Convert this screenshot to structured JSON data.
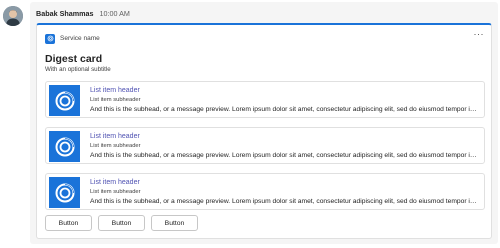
{
  "message": {
    "sender": "Babak Shammas",
    "time": "10:00 AM"
  },
  "card": {
    "service_name": "Service name",
    "more_label": "···",
    "title": "Digest card",
    "subtitle": "With an optional subtitle",
    "items": [
      {
        "header": "List item header",
        "subheader": "List item subheader",
        "preview": "And this is the subhead, or a message preview. Lorem ipsum dolor sit amet, consectetur adipiscing elit, sed do eiusmod tempor incididunt ut labore et dolore magna aliqua."
      },
      {
        "header": "List item header",
        "subheader": "List item subheader",
        "preview": "And this is the subhead, or a message preview. Lorem ipsum dolor sit amet, consectetur adipiscing elit, sed do eiusmod tempor incididunt ut labore et dolore magna aliqua."
      },
      {
        "header": "List item header",
        "subheader": "List item subheader",
        "preview": "And this is the subhead, or a message preview. Lorem ipsum dolor sit amet, consectetur adipiscing elit, sed do eiusmod tempor incididunt ut labore et dolore magna aliqua."
      }
    ],
    "buttons": [
      "Button",
      "Button",
      "Button"
    ]
  },
  "icons": {
    "avatar": "user-avatar",
    "service": "service-logo-icon",
    "item_image": "ring-logo-icon",
    "more": "more-options-icon"
  },
  "colors": {
    "accent": "#1a73d9",
    "link": "#4f52b2",
    "card_background": "#ffffff",
    "message_background": "#f5f5f5"
  }
}
